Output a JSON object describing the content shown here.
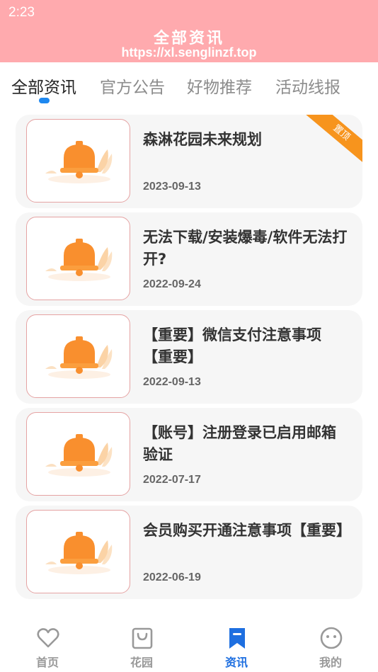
{
  "status_bar": {
    "time": "2:23"
  },
  "header": {
    "title": "全部资讯",
    "url": "https://xl.senglinzf.top"
  },
  "tabs": [
    {
      "label": "全部资讯",
      "active": true
    },
    {
      "label": "官方公告",
      "active": false
    },
    {
      "label": "好物推荐",
      "active": false
    },
    {
      "label": "活动线报",
      "active": false
    }
  ],
  "articles": [
    {
      "title": "森淋花园未来规划",
      "date": "2023-09-13",
      "badge": "置顶",
      "thumb_icon": "bell-icon"
    },
    {
      "title": "无法下载/安装爆毒/软件无法打开?",
      "date": "2022-09-24",
      "thumb_icon": "bell-icon"
    },
    {
      "title": "【重要】微信支付注意事项【重要】",
      "date": "2022-09-13",
      "thumb_icon": "bell-icon"
    },
    {
      "title": "【账号】注册登录已启用邮箱验证",
      "date": "2022-07-17",
      "thumb_icon": "bell-icon"
    },
    {
      "title": "会员购买开通注意事项【重要】",
      "date": "2022-06-19",
      "thumb_icon": "bell-icon"
    }
  ],
  "bottom_nav": [
    {
      "label": "首页",
      "icon": "heart-icon",
      "active": false
    },
    {
      "label": "花园",
      "icon": "bag-icon",
      "active": false
    },
    {
      "label": "资讯",
      "icon": "bookmark-icon",
      "active": true
    },
    {
      "label": "我的",
      "icon": "face-icon",
      "active": false
    }
  ],
  "colors": {
    "header_bg": "#ffaaae",
    "accent": "#1e88f0",
    "badge": "#f7941d",
    "bell": "#f98f2e",
    "card_bg": "#f6f6f6",
    "thumb_border": "#e5a3a3"
  }
}
